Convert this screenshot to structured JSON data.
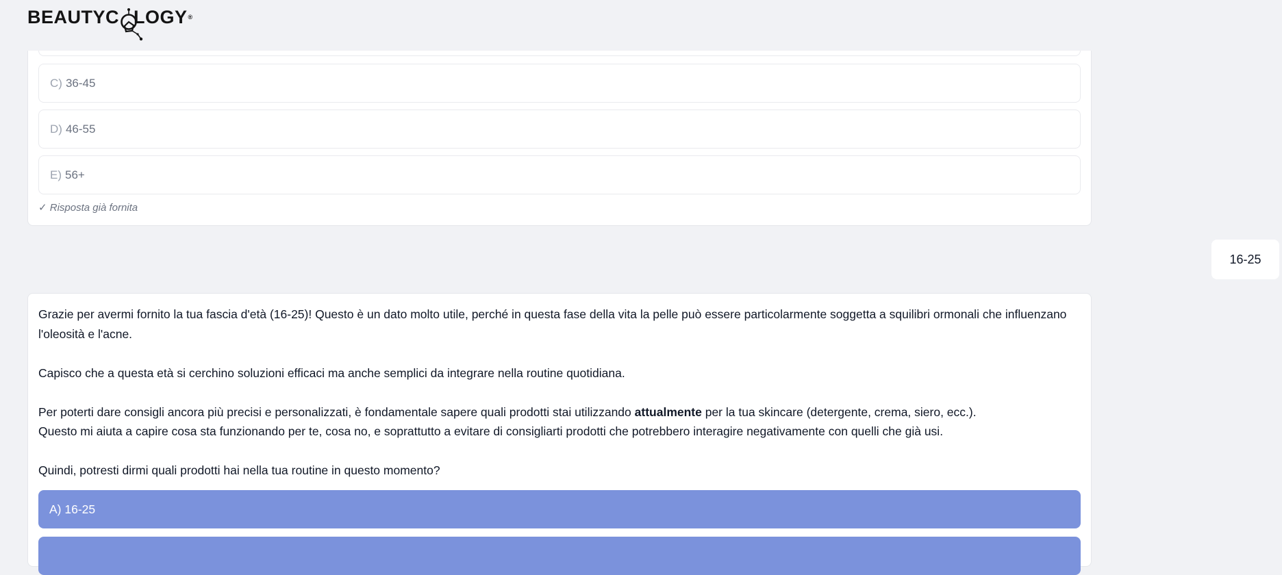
{
  "header": {
    "logo_pre": "BEAUTYC",
    "logo_post": "LOGY",
    "logo_reg": "®"
  },
  "previous_question": {
    "options": [
      {
        "letter": "C)",
        "value": "36-45"
      },
      {
        "letter": "D)",
        "value": "46-55"
      },
      {
        "letter": "E)",
        "value": "56+"
      }
    ],
    "answered_note": "✓ Risposta già fornita"
  },
  "user_reply": "16-25",
  "assistant_message": {
    "p1": "Grazie per avermi fornito la tua fascia d'età (16-25)! Questo è un dato molto utile, perché in questa fase della vita la pelle può essere particolarmente soggetta a squilibri ormonali che influenzano l'oleosità e l'acne.",
    "p2": "Capisco che a questa età si cerchino soluzioni efficaci ma anche semplici da integrare nella routine quotidiana.",
    "p3_before": "Per poterti dare consigli ancora più precisi e personalizzati, è fondamentale sapere quali prodotti stai utilizzando ",
    "p3_bold": "attualmente",
    "p3_after": " per la tua skincare (detergente, crema, siero, ecc.).",
    "p4": "Questo mi aiuta a capire cosa sta funzionando per te, cosa no, e soprattutto a evitare di consigliarti prodotti che potrebbero interagire negativamente con quelli che già usi.",
    "p5": "Quindi, potresti dirmi quali prodotti hai nella tua routine in questo momento?",
    "choices": [
      {
        "label": "A) 16-25"
      }
    ]
  }
}
